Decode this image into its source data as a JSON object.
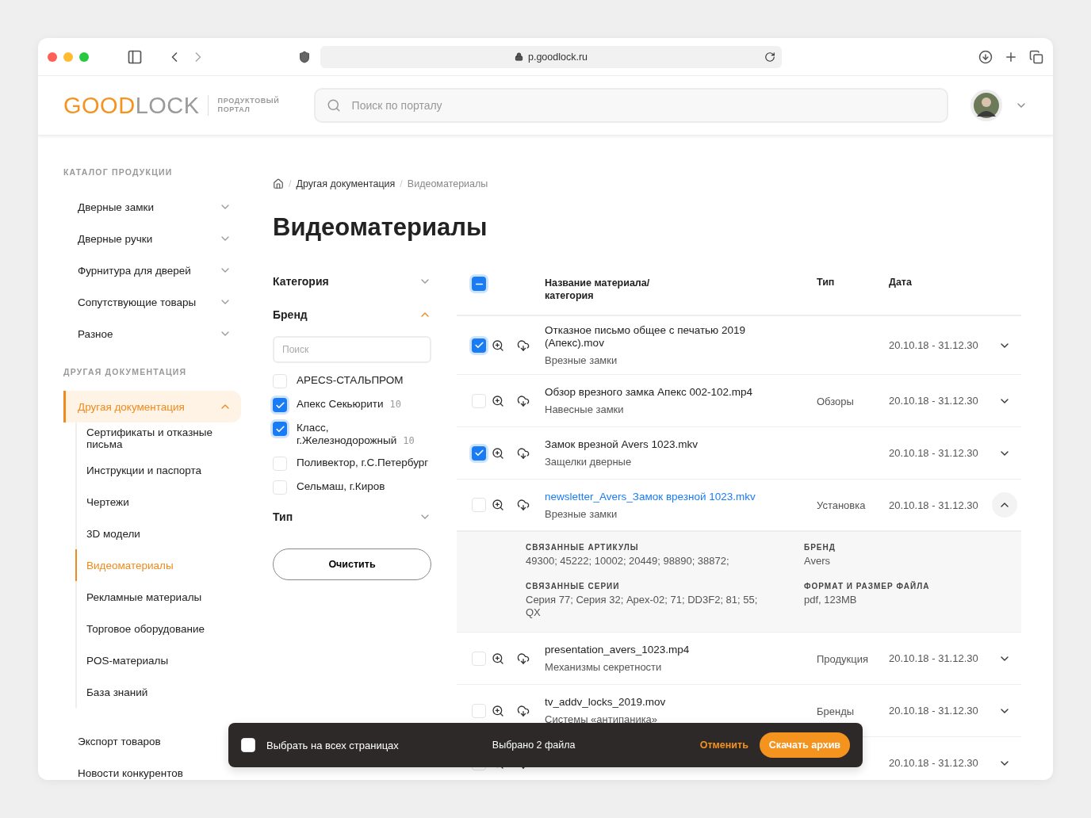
{
  "browser": {
    "url": "p.goodlock.ru"
  },
  "header": {
    "logo": {
      "primary": "GOOD",
      "secondary": "LOCK"
    },
    "tagline": "ПРОДУКТОВЫЙ ПОРТАЛ",
    "search": {
      "placeholder": "Поиск по порталу"
    }
  },
  "sidebar": {
    "sections": [
      {
        "title": "КАТАЛОГ ПРОДУКЦИИ",
        "items": [
          {
            "label": "Дверные замки",
            "expanded": false,
            "selected": false
          },
          {
            "label": "Дверные ручки",
            "expanded": false,
            "selected": false
          },
          {
            "label": "Фурнитура для дверей",
            "expanded": false,
            "selected": false
          },
          {
            "label": "Сопутствующие товары",
            "expanded": false,
            "selected": false
          },
          {
            "label": "Разное",
            "expanded": false,
            "selected": false
          }
        ]
      },
      {
        "title": "ДРУГАЯ ДОКУМЕНТАЦИЯ",
        "items": [
          {
            "label": "Другая документация",
            "expanded": true,
            "selected": true,
            "children": [
              {
                "label": "Сертификаты и отказные письма",
                "selected": false
              },
              {
                "label": "Инструкции и паспорта",
                "selected": false
              },
              {
                "label": "Чертежи",
                "selected": false
              },
              {
                "label": "3D модели",
                "selected": false
              },
              {
                "label": "Видеоматериалы",
                "selected": true
              },
              {
                "label": "Рекламные материалы",
                "selected": false
              },
              {
                "label": "Торговое оборудование",
                "selected": false
              },
              {
                "label": "POS-материалы",
                "selected": false
              },
              {
                "label": "База знаний",
                "selected": false
              }
            ]
          }
        ]
      },
      {
        "items": [
          {
            "label": "Экспорт товаров",
            "selected": false
          },
          {
            "label": "Новости конкурентов",
            "selected": false
          }
        ]
      }
    ]
  },
  "breadcrumbs": {
    "separator": "/",
    "items": [
      "Другая документация",
      "Видеоматериалы"
    ]
  },
  "title": "Видеоматериалы",
  "filters": [
    {
      "label": "Категория",
      "expanded": false
    },
    {
      "label": "Бренд",
      "expanded": true,
      "search_placeholder": "Поиск",
      "options": [
        {
          "label": "APECS-СТАЛЬПРОМ",
          "checked": false
        },
        {
          "label": "Апекс Секьюрити",
          "count": "10",
          "checked": true
        },
        {
          "label": "Класс, г.Железнодорожный",
          "count": "10",
          "checked": true
        },
        {
          "label": "Поливектор, г.С.Петербург",
          "checked": false
        },
        {
          "label": "Сельмаш, г.Киров",
          "checked": false
        }
      ]
    },
    {
      "label": "Тип",
      "expanded": false
    }
  ],
  "clear_button": "Очистить",
  "table": {
    "select_all": {
      "indeterminate": true
    },
    "columns": [
      "Название материала/ категория",
      "Тип",
      "Дата"
    ],
    "rows": [
      {
        "name": "Отказное письмо общее с печатью 2019 (Апекс).mov",
        "category": "Врезные замки",
        "date": "20.10.18 - 31.12.30",
        "checked": true,
        "expanded": false
      },
      {
        "name": "Обзор врезного замка Апекс 002-102.mp4",
        "category": "Навесные замки",
        "type": "Обзоры",
        "date": "20.10.18 - 31.12.30",
        "checked": false,
        "expanded": false
      },
      {
        "name": "Замок врезной Avers 1023.mkv",
        "category": "Защелки дверные",
        "date": "20.10.18 - 31.12.30",
        "checked": true,
        "expanded": false
      },
      {
        "name": "newsletter_Avers_Замок врезной 1023.mkv",
        "category": "Врезные замки",
        "type": "Установка",
        "date": "20.10.18 - 31.12.30",
        "checked": false,
        "highlighted": true,
        "expanded": true,
        "details": [
          {
            "label": "СВЯЗАННЫЕ АРТИКУЛЫ",
            "value": "49300; 45222; 10002; 20449; 98890; 38872;"
          },
          {
            "label": "БРЕНД",
            "value": "Avers"
          },
          {
            "label": "СВЯЗАННЫЕ СЕРИИ",
            "value": "Серия 77; Серия 32; Apex-02; 71; DD3F2; 81; 55; QX"
          },
          {
            "label": "ФОРМАТ И РАЗМЕР ФАЙЛА",
            "value": "pdf, 123MB"
          }
        ]
      },
      {
        "name": "presentation_avers_1023.mp4",
        "category": "Механизмы секретности",
        "type": "Продукция",
        "date": "20.10.18 - 31.12.30",
        "checked": false,
        "expanded": false
      },
      {
        "name": "tv_addv_locks_2019.mov",
        "category": "Системы «антипаника»",
        "type": "Бренды",
        "date": "20.10.18 - 31.12.30",
        "checked": false,
        "expanded": false
      },
      {
        "date": "20.10.18 - 31.12.30",
        "checked": false,
        "expanded": false
      }
    ]
  },
  "selection_bar": {
    "select_all_pages": {
      "label": "Выбрать на всех страницах",
      "checked": false
    },
    "count": "Выбрано 2 файла",
    "cancel": "Отменить",
    "download": "Скачать архив"
  }
}
